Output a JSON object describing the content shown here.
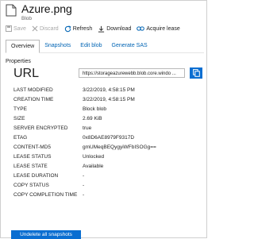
{
  "header": {
    "title": "Azure.png",
    "subtitle": "Blob"
  },
  "toolbar": {
    "save": "Save",
    "discard": "Discard",
    "refresh": "Refresh",
    "download": "Download",
    "acquire_lease": "Acquire lease"
  },
  "tabs": [
    "Overview",
    "Snapshots",
    "Edit blob",
    "Generate SAS"
  ],
  "section_title": "Properties",
  "url": {
    "label": "URL",
    "value": "https://storageazurewebb.blob.core.windo ..."
  },
  "properties": [
    {
      "key": "LAST MODIFIED",
      "value": "3/22/2019, 4:58:15 PM"
    },
    {
      "key": "CREATION TIME",
      "value": "3/22/2019, 4:58:15 PM"
    },
    {
      "key": "TYPE",
      "value": "Block blob"
    },
    {
      "key": "SIZE",
      "value": "2.69 KiB"
    },
    {
      "key": "SERVER ENCRYPTED",
      "value": "true"
    },
    {
      "key": "ETAG",
      "value": "0x8D6AE8979F9317D"
    },
    {
      "key": "CONTENT-MD5",
      "value": "gmUMeqBEQygyiWFbISOGg=="
    },
    {
      "key": "LEASE STATUS",
      "value": "Unlocked"
    },
    {
      "key": "LEASE STATE",
      "value": "Available"
    },
    {
      "key": "LEASE DURATION",
      "value": "-"
    },
    {
      "key": "COPY STATUS",
      "value": "-"
    },
    {
      "key": "COPY COMPLETION TIME",
      "value": "-"
    }
  ],
  "undelete_button": "Undelete all snapshots",
  "colors": {
    "accent": "#0a6ed1",
    "link": "#0064b4",
    "disabled": "#a8a8a8"
  },
  "icons": {
    "file": "file-icon",
    "save": "save-icon",
    "discard": "discard-icon",
    "refresh": "refresh-icon",
    "download": "download-icon",
    "acquire_lease": "link-icon",
    "copy": "copy-icon"
  }
}
